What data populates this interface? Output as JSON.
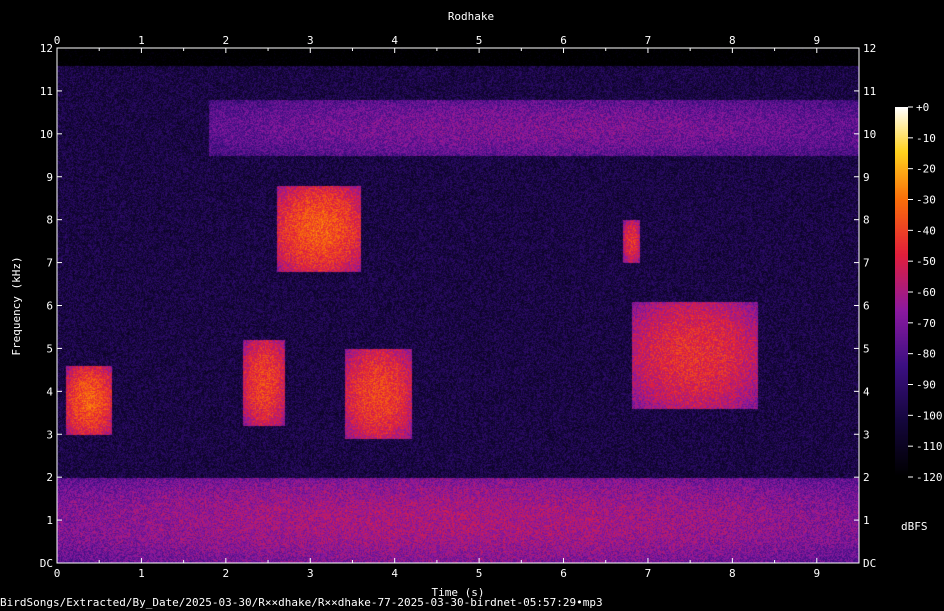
{
  "file_path": "BirdSongs/Extracted/By_Date/2025-03-30/R××dhake/R××dhake-77-2025-03-30-birdnet-05:57:29•mp3",
  "chart_data": {
    "type": "heatmap",
    "title": "Rodhake",
    "xlabel": "Time (s)",
    "ylabel": "Frequency (kHz)",
    "xlim": [
      0,
      9.5
    ],
    "ylim": [
      0,
      12
    ],
    "x_ticks": [
      "0",
      "1",
      "2",
      "3",
      "4",
      "5",
      "6",
      "7",
      "8",
      "9"
    ],
    "y_ticks": [
      "DC",
      "1",
      "2",
      "3",
      "4",
      "5",
      "6",
      "7",
      "8",
      "9",
      "10",
      "11",
      "12"
    ],
    "colorbar": {
      "label": "dBFS",
      "ticks": [
        "+0",
        "-10",
        "-20",
        "-30",
        "-40",
        "-50",
        "-60",
        "-70",
        "-80",
        "-90",
        "-100",
        "-110",
        "-120"
      ],
      "range": [
        -120,
        0
      ]
    },
    "grid": false,
    "legend_position": "right",
    "colors": {
      "background": "#000000",
      "low": "#000000",
      "mid_low": "#2b0c6e",
      "mid": "#8a1a9c",
      "mid_high": "#e8173a",
      "high": "#ffb000",
      "max": "#ffffff"
    },
    "energy_regions": [
      {
        "t0": 0.0,
        "t1": 9.5,
        "f0": 0.0,
        "f1": 2.0,
        "level_db": -60
      },
      {
        "t0": 0.1,
        "t1": 0.65,
        "f0": 3.0,
        "f1": 4.6,
        "level_db": -35
      },
      {
        "t0": 2.2,
        "t1": 2.7,
        "f0": 3.2,
        "f1": 5.2,
        "level_db": -40
      },
      {
        "t0": 2.6,
        "t1": 3.6,
        "f0": 6.8,
        "f1": 8.8,
        "level_db": -35
      },
      {
        "t0": 3.4,
        "t1": 4.2,
        "f0": 2.9,
        "f1": 5.0,
        "level_db": -40
      },
      {
        "t0": 6.8,
        "t1": 8.3,
        "f0": 3.6,
        "f1": 6.1,
        "level_db": -45
      },
      {
        "t0": 6.7,
        "t1": 6.9,
        "f0": 7.0,
        "f1": 8.0,
        "level_db": -45
      },
      {
        "t0": 1.8,
        "t1": 9.5,
        "f0": 9.5,
        "f1": 10.8,
        "level_db": -70
      }
    ]
  }
}
